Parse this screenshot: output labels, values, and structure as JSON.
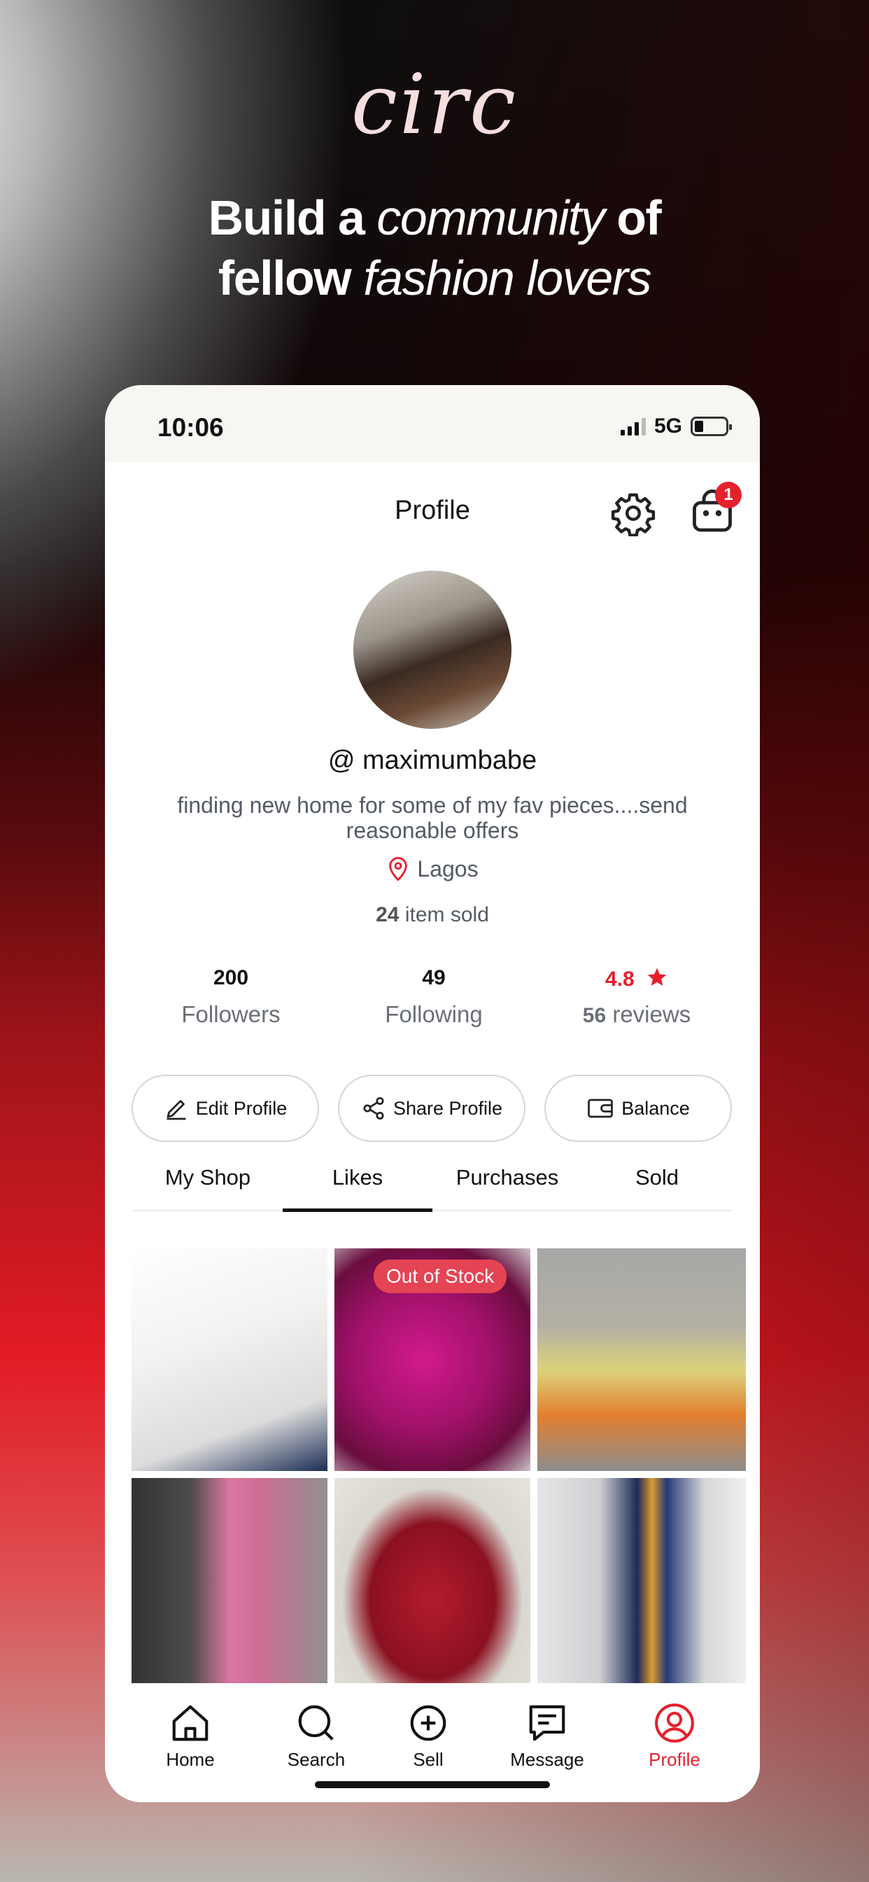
{
  "promo": {
    "brand": "circ",
    "headline_part1": "Build a",
    "headline_italic1": "community",
    "headline_part2": "of",
    "headline_part3": "fellow",
    "headline_italic2": "fashion lovers"
  },
  "status_bar": {
    "time": "10:06",
    "network": "5G"
  },
  "header": {
    "title": "Profile",
    "cart_badge": "1"
  },
  "profile": {
    "handle": "@ maximumbabe",
    "bio": "finding new home for some of my fav pieces....send reasonable offers",
    "location": "Lagos",
    "items_sold_count": "24",
    "items_sold_label": "item sold"
  },
  "stats": {
    "followers_count": "200",
    "followers_label": "Followers",
    "following_count": "49",
    "following_label": "Following",
    "rating": "4.8",
    "reviews_count": "56",
    "reviews_label": "reviews"
  },
  "actions": {
    "edit_profile": "Edit Profile",
    "share_profile": "Share Profile",
    "balance": "Balance"
  },
  "tabs": [
    "My Shop",
    "Likes",
    "Purchases",
    "Sold"
  ],
  "active_tab": "Likes",
  "grid": {
    "out_of_stock_label": "Out of Stock"
  },
  "bottom_nav": {
    "home": "Home",
    "search": "Search",
    "sell": "Sell",
    "message": "Message",
    "profile": "Profile"
  },
  "colors": {
    "accent": "#e5202d",
    "text_primary": "#111111",
    "text_secondary": "#545b66"
  }
}
